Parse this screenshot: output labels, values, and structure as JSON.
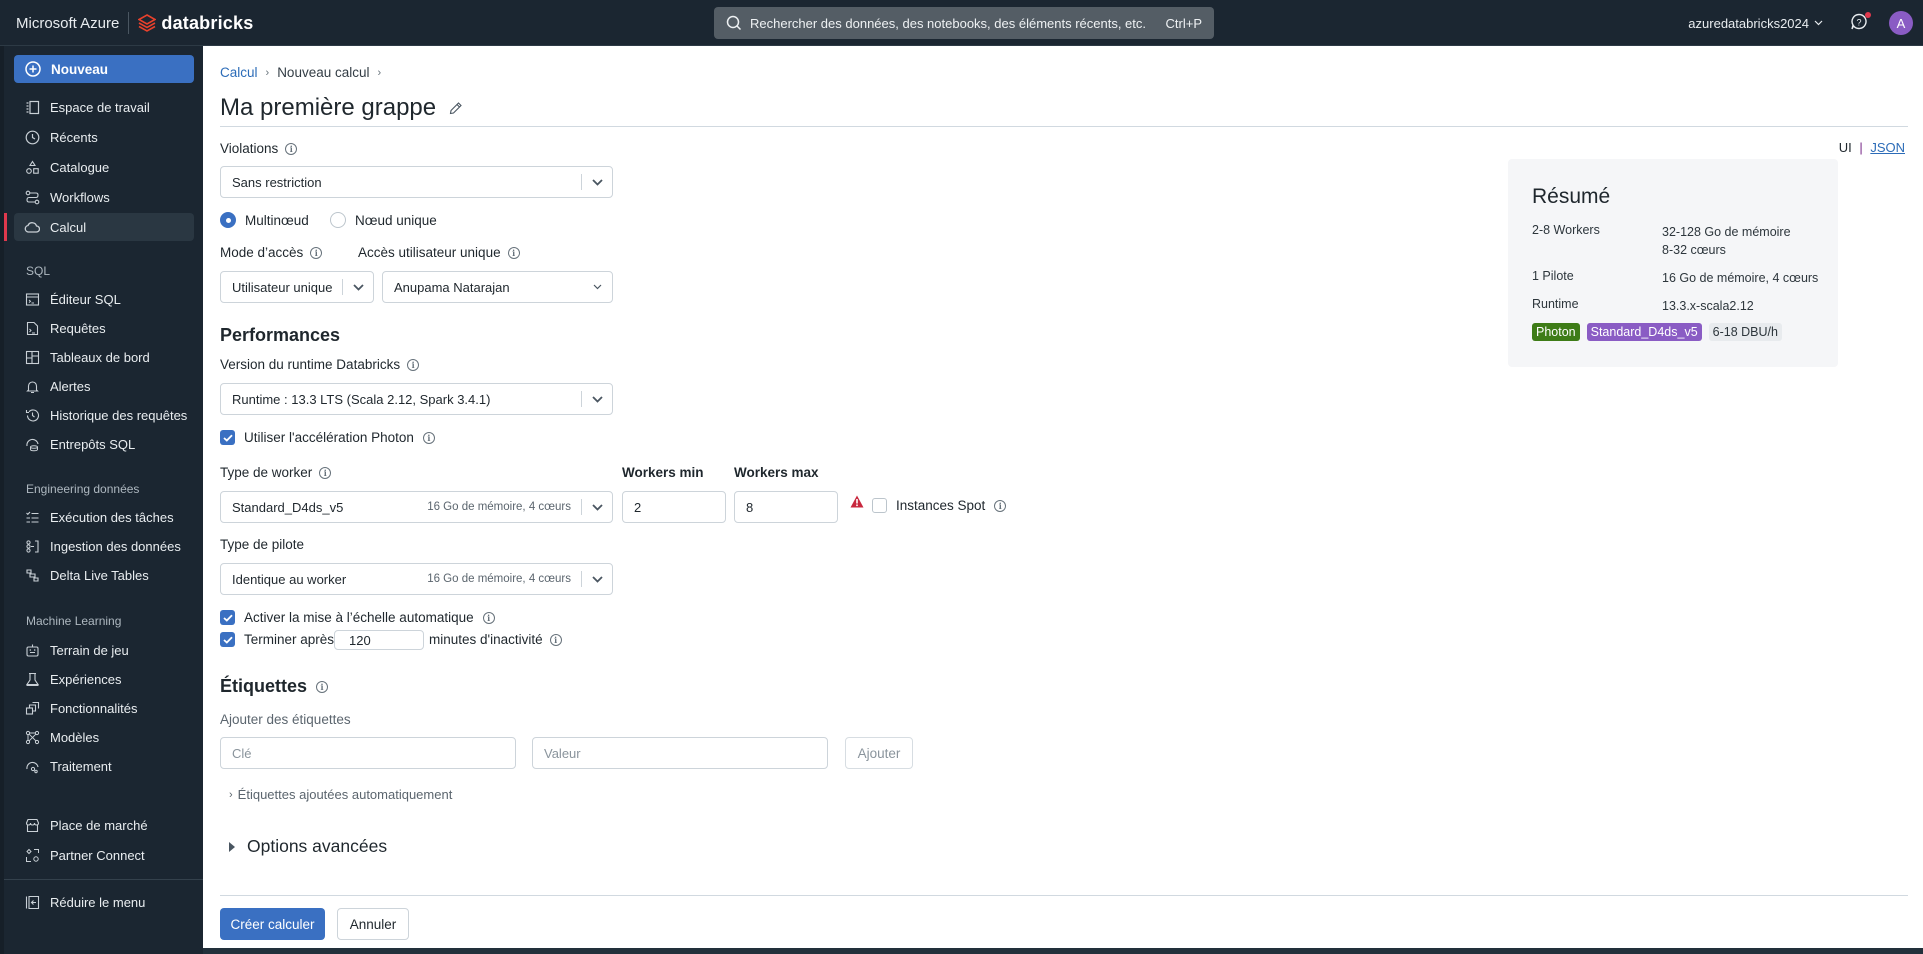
{
  "topbar": {
    "brand_ms": "Microsoft Azure",
    "brand_db": "databricks",
    "search_placeholder": "Rechercher des données, des notebooks, des éléments récents, etc.",
    "search_shortcut": "Ctrl+P",
    "workspace": "azuredatabricks2024",
    "avatar_initial": "A"
  },
  "sidebar": {
    "new_label": "Nouveau",
    "main_items": [
      {
        "label": "Espace de travail",
        "icon": "workspace-icon"
      },
      {
        "label": "Récents",
        "icon": "clock-icon"
      },
      {
        "label": "Catalogue",
        "icon": "catalog-icon"
      },
      {
        "label": "Workflows",
        "icon": "workflows-icon"
      },
      {
        "label": "Calcul",
        "icon": "cloud-icon",
        "active": true
      }
    ],
    "sql_section": "SQL",
    "sql_items": [
      {
        "label": "Éditeur SQL"
      },
      {
        "label": "Requêtes"
      },
      {
        "label": "Tableaux de bord"
      },
      {
        "label": "Alertes"
      },
      {
        "label": "Historique des requêtes"
      },
      {
        "label": "Entrepôts SQL"
      }
    ],
    "eng_section": "Engineering données",
    "eng_items": [
      {
        "label": "Exécution des tâches"
      },
      {
        "label": "Ingestion des données"
      },
      {
        "label": "Delta Live Tables"
      }
    ],
    "ml_section": "Machine Learning",
    "ml_items": [
      {
        "label": "Terrain de jeu"
      },
      {
        "label": "Expériences"
      },
      {
        "label": "Fonctionnalités"
      },
      {
        "label": "Modèles"
      },
      {
        "label": "Traitement"
      }
    ],
    "bottom_items": [
      {
        "label": "Place de marché"
      },
      {
        "label": "Partner Connect"
      }
    ],
    "collapse_label": "Réduire le menu"
  },
  "breadcrumb": {
    "root": "Calcul",
    "current": "Nouveau calcul"
  },
  "page_title": "Ma première grappe",
  "view_toggle": {
    "ui": "UI",
    "sep": "|",
    "json": "JSON"
  },
  "form": {
    "policy_label": "Violations",
    "policy_value": "Sans restriction",
    "node_type": {
      "multi": "Multinœud",
      "single": "Nœud unique",
      "selected": "multi"
    },
    "access_mode_label": "Mode d’accès",
    "access_mode_value": "Utilisateur unique",
    "single_user_label": "Accès utilisateur unique",
    "single_user_value": "Anupama Natarajan",
    "performance_heading": "Performances",
    "runtime_label": "Version du runtime Databricks",
    "runtime_value": "Runtime : 13.3 LTS (Scala 2.12, Spark 3.4.1)",
    "photon_label": "Utiliser l'accélération Photon",
    "photon_checked": true,
    "worker_type_label": "Type de worker",
    "worker_type_value": "Standard_D4ds_v5",
    "worker_type_meta": "16 Go de mémoire, 4 cœurs",
    "workers_min_label": "Workers min",
    "workers_min_value": "2",
    "workers_max_label": "Workers max",
    "workers_max_value": "8",
    "spot_label": "Instances Spot",
    "spot_checked": false,
    "driver_type_label": "Type de pilote",
    "driver_type_value": "Identique au worker",
    "driver_type_meta": "16 Go de mémoire, 4 cœurs",
    "autoscale_label": "Activer la mise à l’échelle automatique",
    "autoscale_checked": true,
    "terminate_label": "Terminer après",
    "terminate_value": "120",
    "terminate_suffix": "minutes d'inactivité",
    "terminate_checked": true,
    "tags_heading": "Étiquettes",
    "tags_sub": "Ajouter des étiquettes",
    "tag_key_placeholder": "Clé",
    "tag_value_placeholder": "Valeur",
    "tag_add_label": "Ajouter",
    "auto_tags_label": "Étiquettes ajoutées automatiquement",
    "advanced_label": "Options avancées"
  },
  "summary": {
    "heading": "Résumé",
    "rows": [
      {
        "k": "2-8 Workers",
        "v1": "32-128 Go de mémoire",
        "v2": "8-32 cœurs"
      },
      {
        "k": "1 Pilote",
        "v1": "16 Go de mémoire, 4 cœurs"
      },
      {
        "k": "Runtime",
        "v1": "13.3.x-scala2.12"
      }
    ],
    "tags": [
      {
        "label": "Photon",
        "color": "#3e7c17"
      },
      {
        "label": "Standard_D4ds_v5",
        "color": "#8a5cc4"
      },
      {
        "label": "6-18 DBU/h",
        "color": "#e8ebee"
      }
    ]
  },
  "footer": {
    "create_label": "Créer calculer",
    "cancel_label": "Annuler"
  },
  "colors": {
    "accent": "#3a70c2",
    "warning": "#c8283e",
    "topbar": "#1b2631"
  }
}
